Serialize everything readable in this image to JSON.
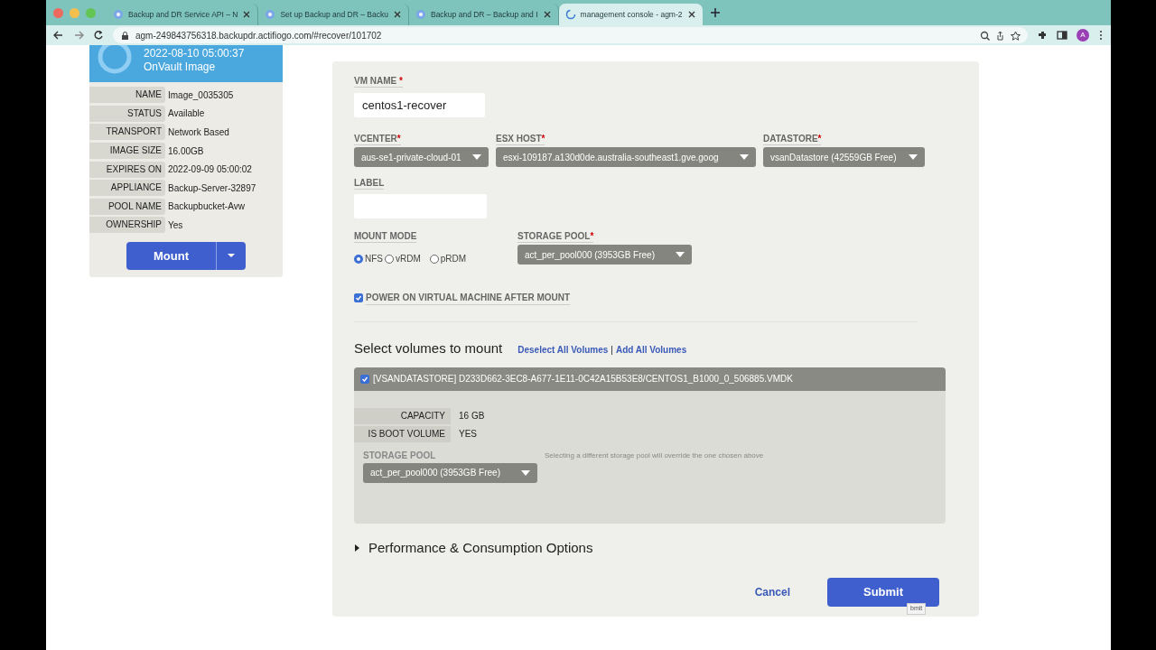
{
  "browser": {
    "tabs": [
      {
        "title": "Backup and DR Service API – N",
        "selected": false
      },
      {
        "title": "Set up Backup and DR – Backu",
        "selected": false
      },
      {
        "title": "Backup and DR – Backup and I",
        "selected": false
      },
      {
        "title": "management console - agm-2",
        "selected": true
      }
    ],
    "url": "agm-249843756318.backupdr.actifiogo.com/#recover/101702",
    "profile_initial": "A"
  },
  "image_panel": {
    "date": "2022-08-10  05:00:37",
    "type": "OnVault Image",
    "details": [
      {
        "label": "NAME",
        "value": "Image_0035305"
      },
      {
        "label": "STATUS",
        "value": "Available"
      },
      {
        "label": "TRANSPORT",
        "value": "Network Based"
      },
      {
        "label": "IMAGE SIZE",
        "value": "16.00GB"
      },
      {
        "label": "EXPIRES ON",
        "value": "2022-09-09 05:00:02"
      },
      {
        "label": "APPLIANCE",
        "value": "Backup-Server-32897"
      },
      {
        "label": "POOL NAME",
        "value": "Backupbucket-Avw"
      },
      {
        "label": "OWNERSHIP",
        "value": "Yes"
      }
    ],
    "mount_button": "Mount"
  },
  "form": {
    "vm_name": {
      "label": "VM NAME",
      "required_mark": "*",
      "value": "centos1-recover"
    },
    "selects": [
      {
        "label": "VCENTER",
        "required_mark": "*",
        "value": "aus-se1-private-cloud-01"
      },
      {
        "label": "ESX HOST",
        "required_mark": "*",
        "value": "esxi-109187.a130d0de.australia-southeast1.gve.goog"
      },
      {
        "label": "DATASTORE",
        "required_mark": "*",
        "value": "vsanDatastore (42559GB Free)"
      }
    ],
    "label_field": {
      "label": "LABEL"
    },
    "mount_mode": {
      "label": "MOUNT MODE",
      "options": [
        {
          "label": "NFS",
          "selected": true
        },
        {
          "label": "vRDM",
          "selected": false
        },
        {
          "label": "pRDM",
          "selected": false
        }
      ]
    },
    "storage_pool": {
      "label": "STORAGE POOL",
      "required_mark": "*",
      "value": "act_per_pool000 (3953GB Free)"
    },
    "power_on": {
      "label": "POWER ON VIRTUAL MACHINE AFTER MOUNT",
      "checked": true
    },
    "volumes": {
      "title": "Select volumes to mount",
      "deselect_link": "Deselect All Volumes",
      "separator": "|",
      "add_link": "Add All Volumes",
      "items": [
        {
          "path": "[VSANDATASTORE] D233D662-3EC8-A677-1E11-0C42A15B53E8/CENTOS1_B1000_0_506885.VMDK",
          "checked": true,
          "details": [
            {
              "label": "CAPACITY",
              "value": "16 GB"
            },
            {
              "label": "IS BOOT VOLUME",
              "value": "YES"
            }
          ],
          "storage_pool": {
            "label": "STORAGE POOL",
            "value": "act_per_pool000 (3953GB Free)"
          },
          "note": "Selecting a different storage pool will override the one chosen above"
        }
      ]
    },
    "performance": {
      "label": "Performance & Consumption Options",
      "expanded": false
    },
    "cancel": "Cancel",
    "submit": "Submit",
    "tooltip": "bmit"
  }
}
